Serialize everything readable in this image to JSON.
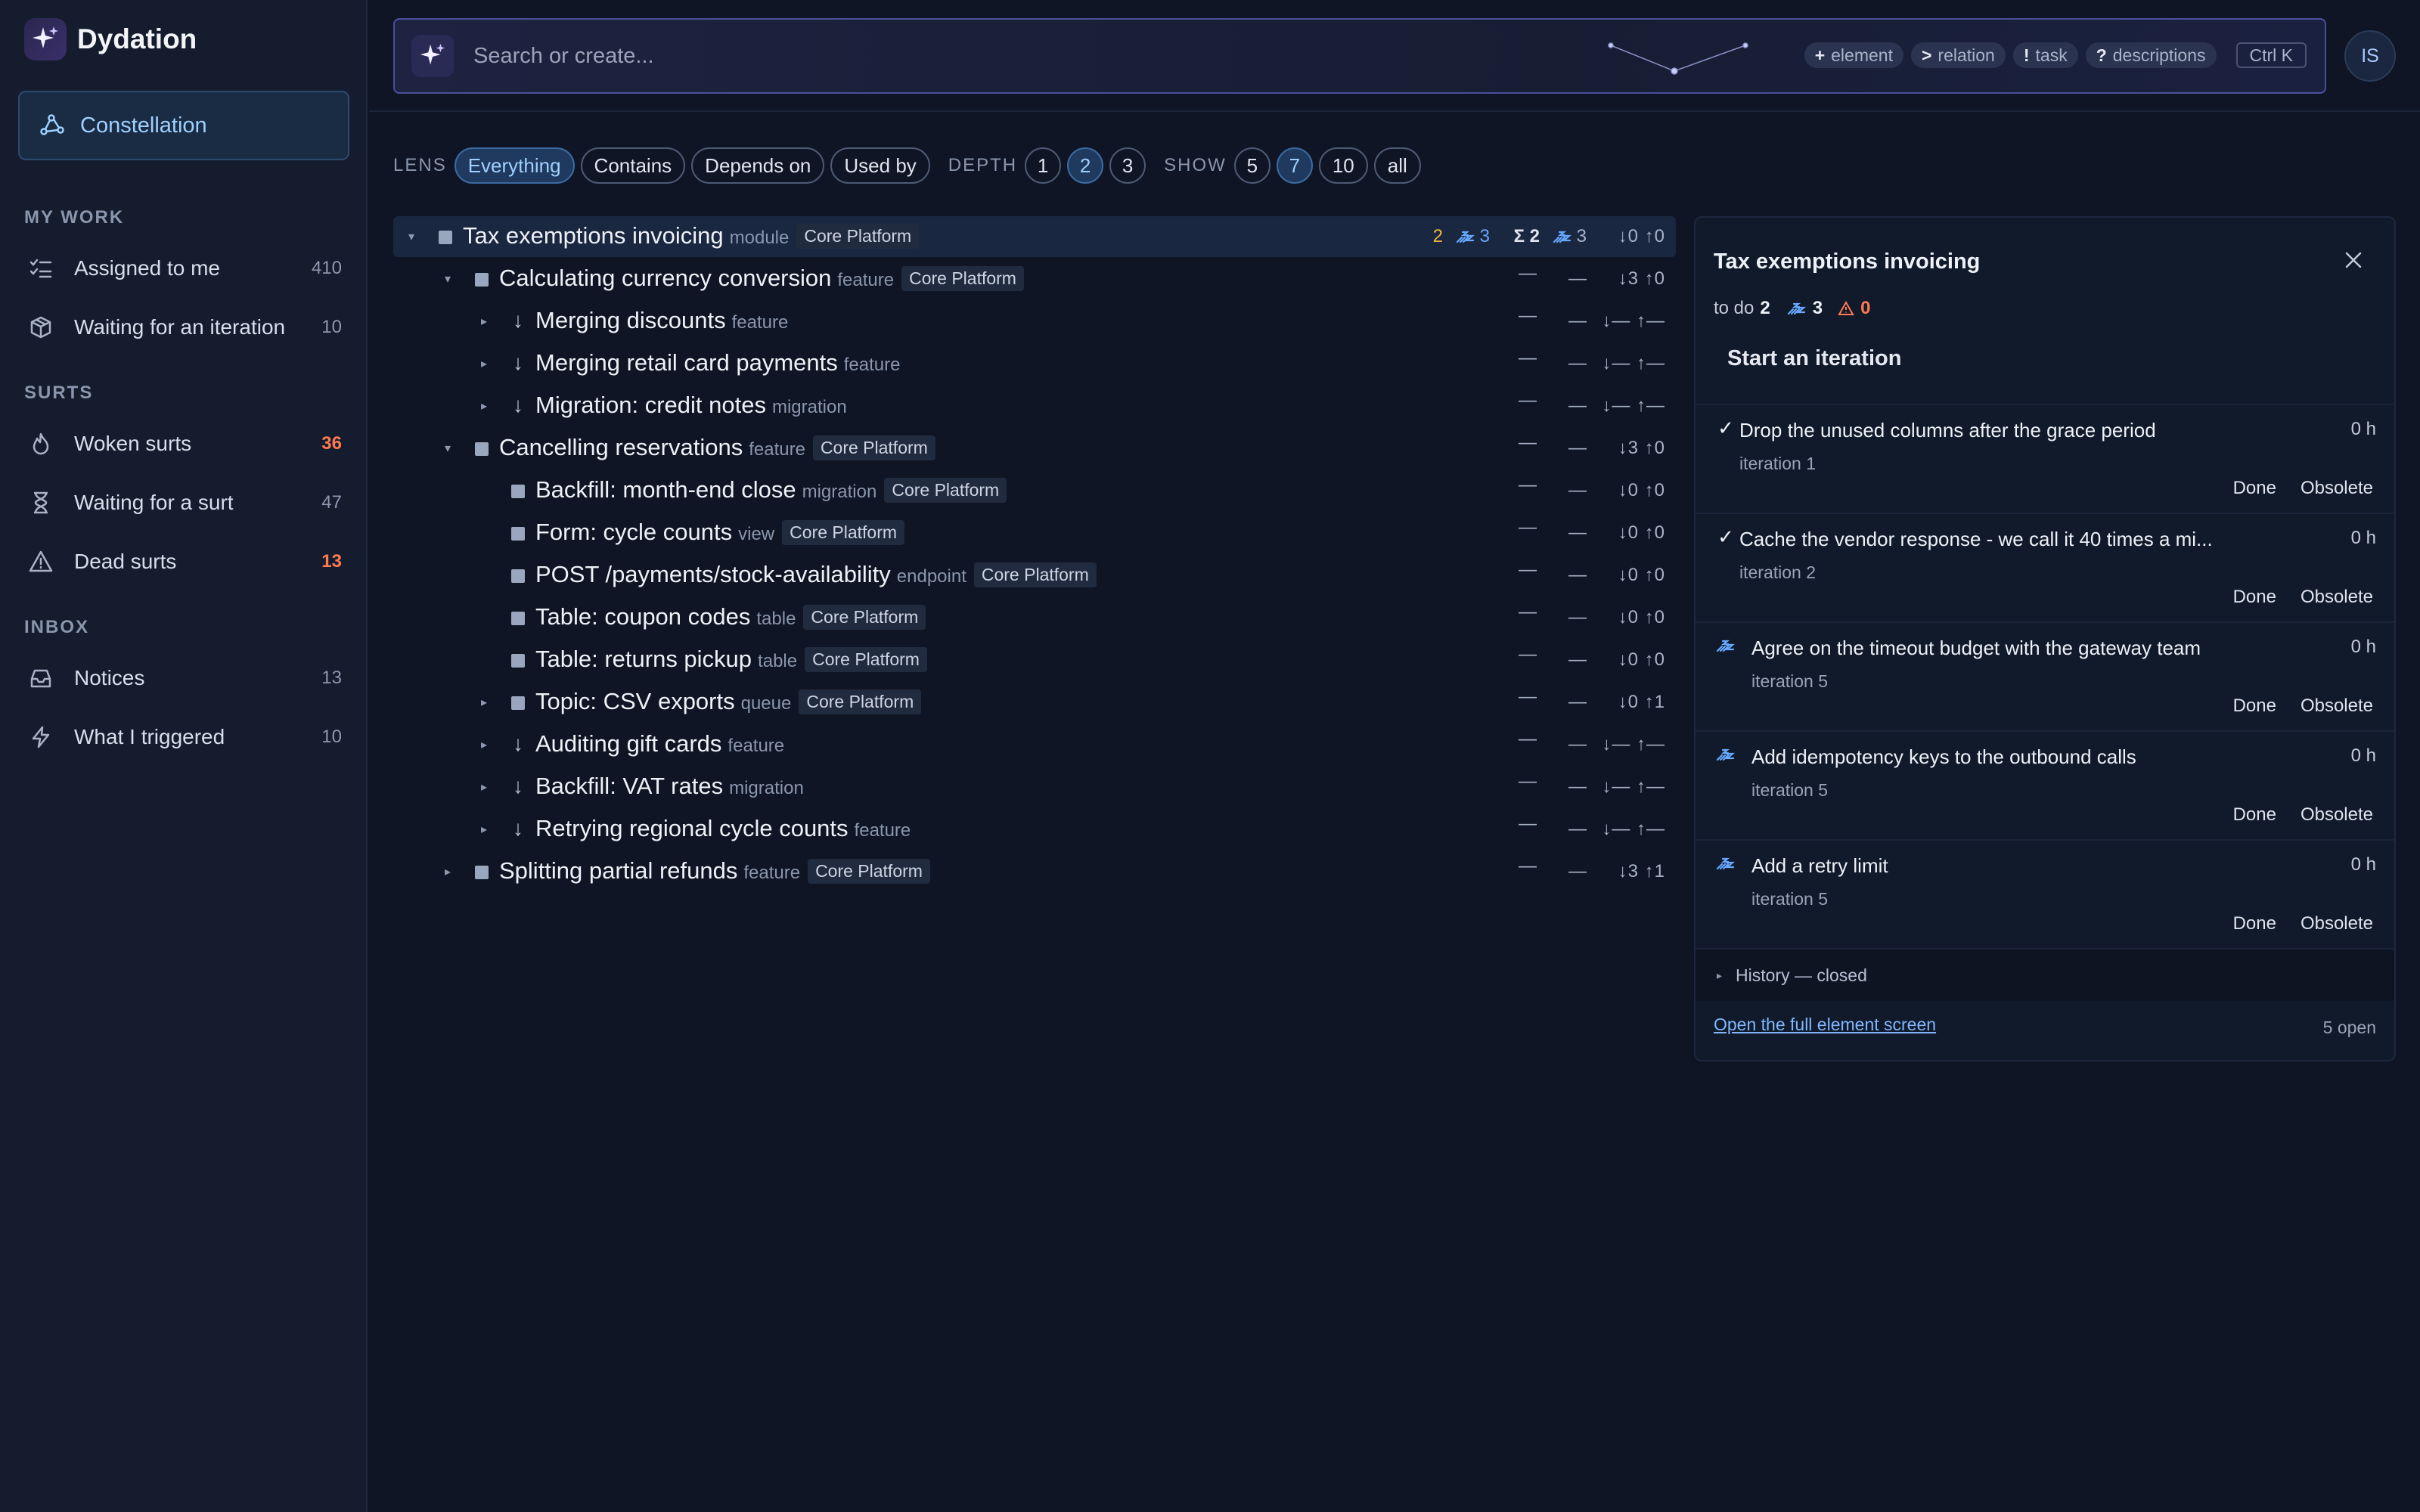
{
  "app": {
    "name": "Dydation",
    "constellation_label": "Constellation"
  },
  "sidebar": {
    "sections": [
      {
        "title": "MY WORK",
        "items": [
          {
            "label": "Assigned to me",
            "count": "410",
            "icon": "checklist-icon"
          },
          {
            "label": "Waiting for an iteration",
            "count": "10",
            "icon": "package-icon"
          }
        ]
      },
      {
        "title": "SURTS",
        "items": [
          {
            "label": "Woken surts",
            "count": "36",
            "icon": "flame-icon",
            "hot": true
          },
          {
            "label": "Waiting for a surt",
            "count": "47",
            "icon": "hourglass-icon"
          },
          {
            "label": "Dead surts",
            "count": "13",
            "icon": "warning-icon",
            "hot": true
          }
        ]
      },
      {
        "title": "INBOX",
        "items": [
          {
            "label": "Notices",
            "count": "13",
            "icon": "inbox-icon"
          },
          {
            "label": "What I triggered",
            "count": "10",
            "icon": "bolt-icon"
          }
        ]
      }
    ]
  },
  "search": {
    "placeholder": "Search or create...",
    "chips": [
      {
        "key": "+",
        "label": "element"
      },
      {
        "key": ">",
        "label": "relation"
      },
      {
        "key": "!",
        "label": "task"
      },
      {
        "key": "?",
        "label": "descriptions"
      }
    ],
    "shortcut": "Ctrl K"
  },
  "avatar": "IS",
  "lensbar": {
    "lens_label": "LENS",
    "lenses": [
      {
        "label": "Everything",
        "active": true
      },
      {
        "label": "Contains",
        "active": false
      },
      {
        "label": "Depends on",
        "active": false
      },
      {
        "label": "Used by",
        "active": false
      }
    ],
    "depth_label": "DEPTH",
    "depths": [
      {
        "label": "1",
        "active": false
      },
      {
        "label": "2",
        "active": true
      },
      {
        "label": "3",
        "active": false
      }
    ],
    "show_label": "SHOW",
    "shows": [
      {
        "label": "5",
        "active": false
      },
      {
        "label": "7",
        "active": true
      },
      {
        "label": "10",
        "active": false
      },
      {
        "label": "all",
        "active": false
      }
    ]
  },
  "tree": [
    {
      "level": 0,
      "caret": "▾",
      "mark": "square",
      "title": "Tax exemptions invoicing",
      "kind": "module",
      "team": "Core Platform",
      "selected": true,
      "todo": "2",
      "iter": "3",
      "sigma": "Σ 2",
      "iter2": "3",
      "down": "↓0",
      "up": "↑0"
    },
    {
      "level": 1,
      "caret": "▾",
      "mark": "square",
      "title": "Calculating currency conversion",
      "kind": "feature",
      "team": "Core Platform",
      "d1": "—",
      "d2": "—",
      "down": "↓3",
      "up": "↑0"
    },
    {
      "level": 2,
      "caret": "▸",
      "mark": "arrow",
      "title": "Merging discounts",
      "kind": "feature",
      "d1": "—",
      "d2": "—",
      "down": "↓—",
      "up": "↑—"
    },
    {
      "level": 2,
      "caret": "▸",
      "mark": "arrow",
      "title": "Merging retail card payments",
      "kind": "feature",
      "d1": "—",
      "d2": "—",
      "down": "↓—",
      "up": "↑—"
    },
    {
      "level": 2,
      "caret": "▸",
      "mark": "arrow",
      "title": "Migration: credit notes",
      "kind": "migration",
      "d1": "—",
      "d2": "—",
      "down": "↓—",
      "up": "↑—"
    },
    {
      "level": 1,
      "caret": "▾",
      "mark": "square",
      "title": "Cancelling reservations",
      "kind": "feature",
      "team": "Core Platform",
      "d1": "—",
      "d2": "—",
      "down": "↓3",
      "up": "↑0"
    },
    {
      "level": 2,
      "caret": "",
      "mark": "square",
      "title": "Backfill: month-end close",
      "kind": "migration",
      "team": "Core Platform",
      "d1": "—",
      "d2": "—",
      "down": "↓0",
      "up": "↑0"
    },
    {
      "level": 2,
      "caret": "",
      "mark": "square",
      "title": "Form: cycle counts",
      "kind": "view",
      "team": "Core Platform",
      "d1": "—",
      "d2": "—",
      "down": "↓0",
      "up": "↑0"
    },
    {
      "level": 2,
      "caret": "",
      "mark": "square",
      "title": "POST /payments/stock-availability",
      "kind": "endpoint",
      "team": "Core Platform",
      "d1": "—",
      "d2": "—",
      "down": "↓0",
      "up": "↑0"
    },
    {
      "level": 2,
      "caret": "",
      "mark": "square",
      "title": "Table: coupon codes",
      "kind": "table",
      "team": "Core Platform",
      "d1": "—",
      "d2": "—",
      "down": "↓0",
      "up": "↑0"
    },
    {
      "level": 2,
      "caret": "",
      "mark": "square",
      "title": "Table: returns pickup",
      "kind": "table",
      "team": "Core Platform",
      "d1": "—",
      "d2": "—",
      "down": "↓0",
      "up": "↑0"
    },
    {
      "level": 2,
      "caret": "▸",
      "mark": "square",
      "title": "Topic: CSV exports",
      "kind": "queue",
      "team": "Core Platform",
      "d1": "—",
      "d2": "—",
      "down": "↓0",
      "up": "↑1"
    },
    {
      "level": 2,
      "caret": "▸",
      "mark": "arrow",
      "title": "Auditing gift cards",
      "kind": "feature",
      "d1": "—",
      "d2": "—",
      "down": "↓—",
      "up": "↑—"
    },
    {
      "level": 2,
      "caret": "▸",
      "mark": "arrow",
      "title": "Backfill: VAT rates",
      "kind": "migration",
      "d1": "—",
      "d2": "—",
      "down": "↓—",
      "up": "↑—"
    },
    {
      "level": 2,
      "caret": "▸",
      "mark": "arrow",
      "title": "Retrying regional cycle counts",
      "kind": "feature",
      "d1": "—",
      "d2": "—",
      "down": "↓—",
      "up": "↑—"
    },
    {
      "level": 1,
      "caret": "▸",
      "mark": "square",
      "title": "Splitting partial refunds",
      "kind": "feature",
      "team": "Core Platform",
      "d1": "—",
      "d2": "—",
      "down": "↓3",
      "up": "↑1"
    }
  ],
  "panel": {
    "title": "Tax exemptions invoicing",
    "todo_label": "to do",
    "todo_count": "2",
    "iter_count": "3",
    "warn_count": "0",
    "start_label": "Start an iteration",
    "tasks": [
      {
        "status": "done",
        "title": "Drop the unused columns after the grace period",
        "iteration": "iteration 1",
        "hours": "0 h",
        "done": "Done",
        "obsolete": "Obsolete"
      },
      {
        "status": "done",
        "title": "Cache the vendor response - we call it 40 times a mi...",
        "iteration": "iteration 2",
        "hours": "0 h",
        "done": "Done",
        "obsolete": "Obsolete"
      },
      {
        "status": "sleeping",
        "title": "Agree on the timeout budget with the gateway team",
        "iteration": "iteration 5",
        "hours": "0 h",
        "done": "Done",
        "obsolete": "Obsolete"
      },
      {
        "status": "sleeping",
        "title": "Add idempotency keys to the outbound calls",
        "iteration": "iteration 5",
        "hours": "0 h",
        "done": "Done",
        "obsolete": "Obsolete"
      },
      {
        "status": "sleeping",
        "title": "Add a retry limit",
        "iteration": "iteration 5",
        "hours": "0 h",
        "done": "Done",
        "obsolete": "Obsolete"
      }
    ],
    "history_label": "History — closed",
    "open_link": "Open the full element screen",
    "open_count": "5 open"
  },
  "colors": {
    "accent": "#9fd0ff",
    "hot": "#ff7a52",
    "todo": "#f0b43c",
    "iteration": "#66a8ff"
  }
}
